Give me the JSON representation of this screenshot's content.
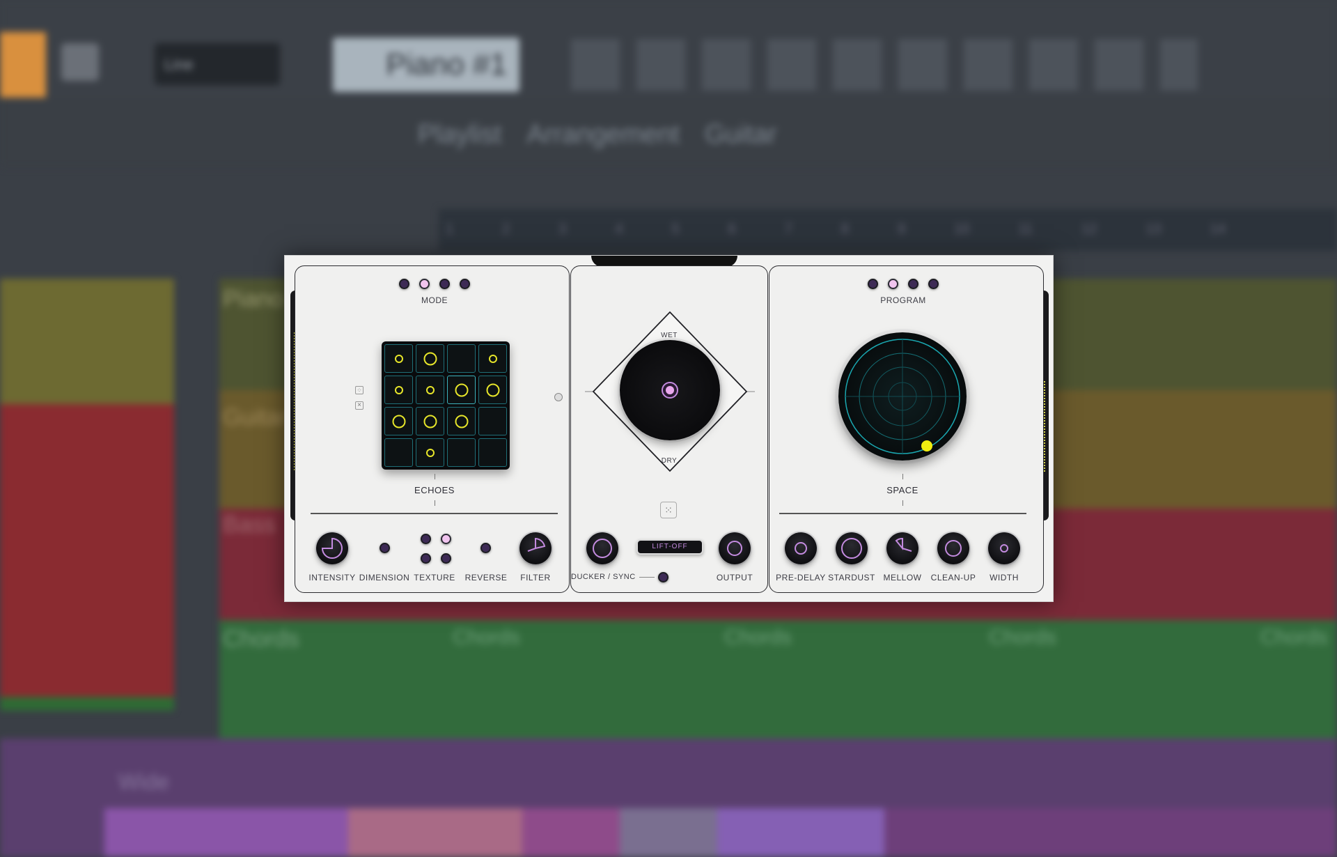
{
  "daw": {
    "channel_placeholder": "Line",
    "instrument_name": "Piano #1",
    "breadcrumb": [
      "Playlist",
      "Arrangement",
      "Guitar"
    ],
    "timeline_numbers": [
      "1",
      "2",
      "3",
      "4",
      "5",
      "6",
      "7",
      "8",
      "9",
      "10",
      "11",
      "12",
      "13",
      "14"
    ],
    "track_labels": [
      "Piano",
      "Guitar",
      "Bass",
      "Chords"
    ],
    "clip_labels": [
      "Chords",
      "Chords",
      "Chords",
      "Chords"
    ],
    "bottom_channel": "Wide"
  },
  "plugin": {
    "left": {
      "mode_label": "MODE",
      "mode_dots": [
        false,
        true,
        false,
        false
      ],
      "echoes_label": "ECHOES",
      "grid": [
        [
          "s",
          "l",
          "",
          "s"
        ],
        [
          "s",
          "s",
          "l",
          "l"
        ],
        [
          "l",
          "l",
          "l",
          ""
        ],
        [
          "",
          "s",
          "",
          ""
        ]
      ],
      "knobs": {
        "intensity": "INTENSITY",
        "dimension": "DIMENSION",
        "texture": "TEXTURE",
        "reverse": "REVERSE",
        "filter": "FILTER"
      }
    },
    "center": {
      "wet_label": "WET",
      "dry_label": "DRY",
      "lift_label": "LIFT-OFF",
      "ducker_label": "DUCKER / SYNC",
      "output_label": "OUTPUT"
    },
    "right": {
      "program_label": "PROGRAM",
      "program_dots": [
        false,
        true,
        false,
        false
      ],
      "space_label": "SPACE",
      "knobs": {
        "predelay": "PRE-DELAY",
        "stardust": "STARDUST",
        "mellow": "MELLOW",
        "cleanup": "CLEAN-UP",
        "width": "WIDTH"
      }
    },
    "colors": {
      "accent_purple": "#c48be0",
      "grid_yellow": "#e7e62a",
      "radar_teal": "#1aa7b0"
    }
  }
}
